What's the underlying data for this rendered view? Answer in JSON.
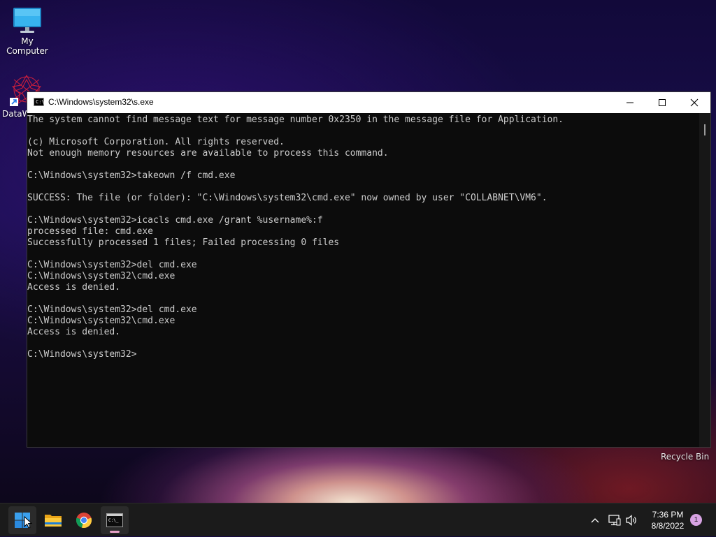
{
  "desktop": {
    "icons": [
      {
        "label": "My Computer",
        "icon": "monitor-icon"
      },
      {
        "label": "DataW",
        "icon": "datawrapper-icon"
      }
    ],
    "recycle_bin_label": "Recycle Bin"
  },
  "window": {
    "title": "C:\\Windows\\system32\\s.exe",
    "icon_text": "C:\\_",
    "controls": [
      "minimize-icon",
      "maximize-icon",
      "close-icon"
    ],
    "console_lines": [
      "The system cannot find message text for message number 0x2350 in the message file for Application.",
      "",
      "(c) Microsoft Corporation. All rights reserved.",
      "Not enough memory resources are available to process this command.",
      "",
      "C:\\Windows\\system32>takeown /f cmd.exe",
      "",
      "SUCCESS: The file (or folder): \"C:\\Windows\\system32\\cmd.exe\" now owned by user \"COLLABNET\\VM6\".",
      "",
      "C:\\Windows\\system32>icacls cmd.exe /grant %username%:f",
      "processed file: cmd.exe",
      "Successfully processed 1 files; Failed processing 0 files",
      "",
      "C:\\Windows\\system32>del cmd.exe",
      "C:\\Windows\\system32\\cmd.exe",
      "Access is denied.",
      "",
      "C:\\Windows\\system32>del cmd.exe",
      "C:\\Windows\\system32\\cmd.exe",
      "Access is denied.",
      "",
      "C:\\Windows\\system32>"
    ]
  },
  "taskbar": {
    "items": [
      "start-icon",
      "file-explorer-icon",
      "chrome-icon",
      "command-prompt-icon"
    ],
    "tray": {
      "icons": [
        "chevron-up-icon",
        "network-icon",
        "volume-icon"
      ],
      "time": "7:36 PM",
      "date": "8/8/2022",
      "notification_count": "1"
    }
  },
  "colors": {
    "console_bg": "#0c0c0c",
    "console_text": "#cccccc",
    "taskbar_bg": "#1b1b1b",
    "notification_badge": "#d8a3e3"
  }
}
